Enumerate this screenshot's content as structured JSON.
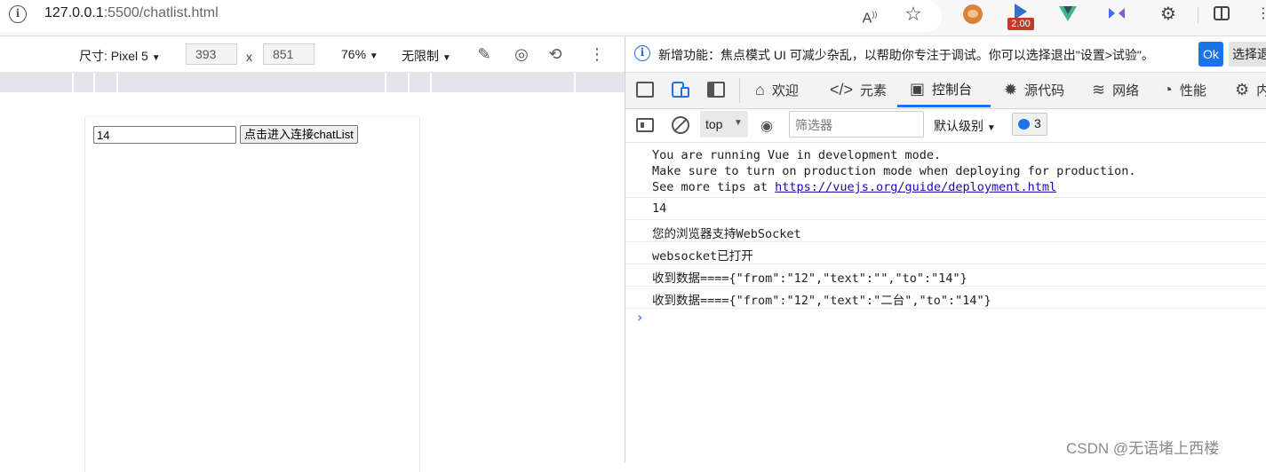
{
  "browser": {
    "url_host": "127.0.0.1",
    "url_rest": ":5500/chatlist.html",
    "extension_badge": "2.00"
  },
  "device_toolbar": {
    "dimensions_label": "尺寸: Pixel 5",
    "width": "393",
    "height": "851",
    "times": "x",
    "zoom": "76%",
    "throttle": "无限制"
  },
  "page": {
    "input_value": "14",
    "button_label": "点击进入连接chatList"
  },
  "devtools": {
    "notice_text": "新增功能：焦点模式 UI 可减少杂乱，以帮助你专注于调试。你可以选择退出\"设置>试验\"。",
    "notice_ok": "Ok",
    "notice_optout": "选择退",
    "tabs": [
      {
        "label": "欢迎",
        "icon": "home-icon"
      },
      {
        "label": "元素",
        "icon": "code-icon"
      },
      {
        "label": "控制台",
        "icon": "console-icon"
      },
      {
        "label": "源代码",
        "icon": "bug-icon"
      },
      {
        "label": "网络",
        "icon": "wifi-icon"
      },
      {
        "label": "性能",
        "icon": "gauge-icon"
      },
      {
        "label": "内",
        "icon": "gear-icon"
      }
    ],
    "active_tab": "控制台",
    "context": "top",
    "filter_placeholder": "筛选器",
    "levels": "默认级别",
    "issues_count": "3"
  },
  "console": {
    "vue_line1": "You are running Vue in development mode.",
    "vue_line2": "Make sure to turn on production mode when deploying for production.",
    "vue_line3_prefix": "See more tips at ",
    "vue_link": "https://vuejs.org/guide/deployment.html",
    "messages": [
      "14",
      "您的浏览器支持WebSocket",
      "websocket已打开",
      "收到数据===={\"from\":\"12\",\"text\":\"\",\"to\":\"14\"}",
      "收到数据===={\"from\":\"12\",\"text\":\"二台\",\"to\":\"14\"}"
    ]
  },
  "watermark": "CSDN @无语堵上西楼",
  "colors": {
    "accent": "#1a73e8",
    "ruler": "#e3e5ea",
    "vue_green": "#41b883"
  }
}
